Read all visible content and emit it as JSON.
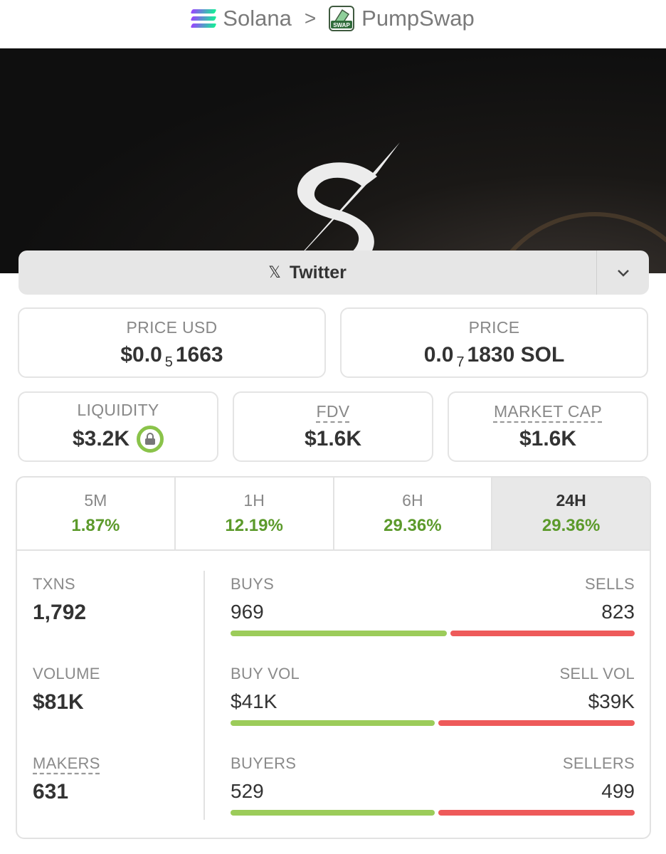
{
  "breadcrumb": {
    "chain": "Solana",
    "separator": ">",
    "dex": "PumpSwap",
    "dex_icon_text": "SWAP"
  },
  "links": {
    "twitter_label": "Twitter"
  },
  "price_usd": {
    "label": "PRICE USD",
    "prefix": "$0.0",
    "zeros": "5",
    "digits": "1663"
  },
  "price_native": {
    "label": "PRICE",
    "prefix": "0.0",
    "zeros": "7",
    "digits": "1830 SOL"
  },
  "liquidity": {
    "label": "LIQUIDITY",
    "value": "$3.2K"
  },
  "fdv": {
    "label": "FDV",
    "value": "$1.6K"
  },
  "market_cap": {
    "label": "MARKET CAP",
    "value": "$1.6K"
  },
  "timeframes": [
    {
      "label": "5M",
      "change": "1.87%"
    },
    {
      "label": "1H",
      "change": "12.19%"
    },
    {
      "label": "6H",
      "change": "29.36%"
    },
    {
      "label": "24H",
      "change": "29.36%",
      "active": true
    }
  ],
  "stats": {
    "txns": {
      "label": "TXNS",
      "value": "1,792"
    },
    "volume": {
      "label": "VOLUME",
      "value": "$81K"
    },
    "makers": {
      "label": "MAKERS",
      "value": "631"
    },
    "buys": {
      "label": "BUYS",
      "value": "969",
      "buy_fraction": 0.54
    },
    "sells": {
      "label": "SELLS",
      "value": "823"
    },
    "buy_vol": {
      "label": "BUY VOL",
      "value": "$41K",
      "buy_fraction": 0.51
    },
    "sell_vol": {
      "label": "SELL VOL",
      "value": "$39K"
    },
    "buyers": {
      "label": "BUYERS",
      "value": "529",
      "buy_fraction": 0.51
    },
    "sellers": {
      "label": "SELLERS",
      "value": "499"
    }
  },
  "colors": {
    "positive": "#5c9a2b",
    "buy_bar": "#9ccc5a",
    "sell_bar": "#ee5a5a"
  }
}
